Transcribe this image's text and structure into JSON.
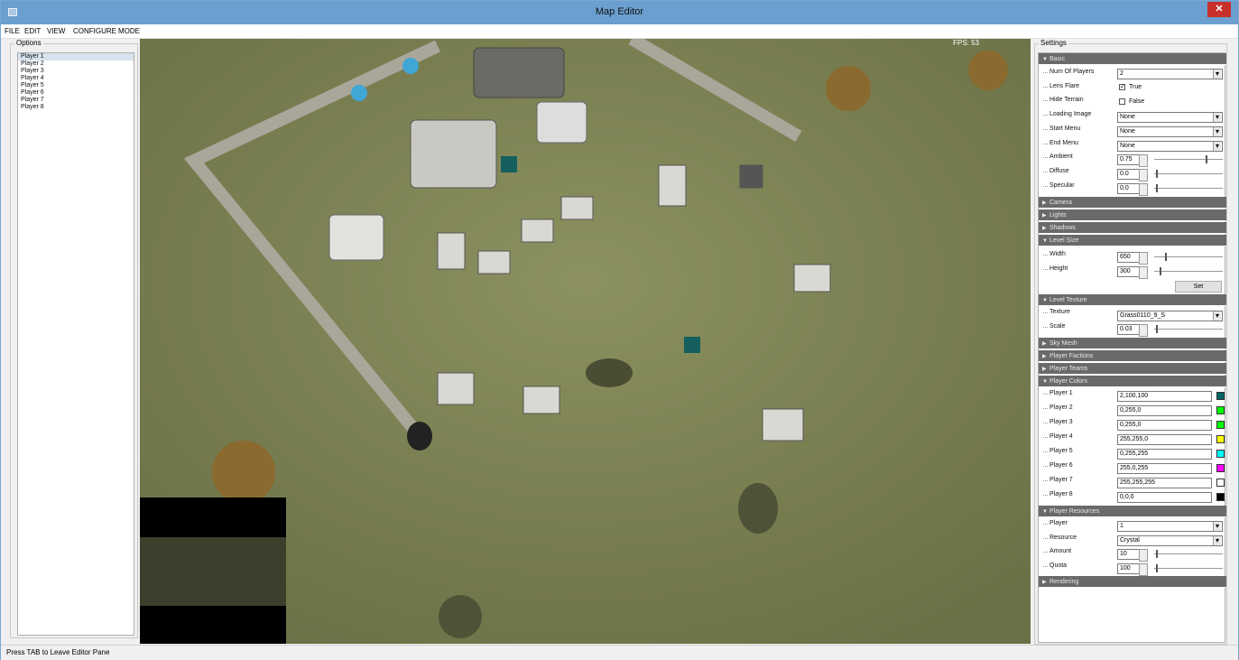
{
  "window": {
    "title": "Map Editor",
    "close_glyph": "✕"
  },
  "menu": [
    "FILE",
    "EDIT",
    "VIEW",
    "CONFIGURE",
    "MODE"
  ],
  "options": {
    "legend": "Options",
    "players": [
      "Player 1",
      "Player 2",
      "Player 3",
      "Player 4",
      "Player 5",
      "Player 6",
      "Player 7",
      "Player 8"
    ],
    "selected_index": 0
  },
  "viewport": {
    "fps": "FPS: 53"
  },
  "settings": {
    "legend": "Settings",
    "basic": {
      "header": "Basic",
      "num_players_label": "Num Of Players",
      "num_players_value": "2",
      "lens_flare_label": "Lens Flare",
      "lens_flare_checked": true,
      "lens_flare_text": "True",
      "hide_terrain_label": "Hide Terrain",
      "hide_terrain_checked": false,
      "hide_terrain_text": "False",
      "loading_image_label": "Loading Image",
      "loading_image_value": "None",
      "start_menu_label": "Start Menu",
      "start_menu_value": "None",
      "end_menu_label": "End Menu",
      "end_menu_value": "None",
      "ambient_label": "Ambient",
      "ambient_value": "0.75",
      "diffuse_label": "Diffuse",
      "diffuse_value": "0.0",
      "specular_label": "Specular",
      "specular_value": "0.0"
    },
    "collapsed_sections": {
      "camera": "Camera",
      "lights": "Lights",
      "shadows": "Shadows"
    },
    "level_size": {
      "header": "Level Size",
      "width_label": "Width",
      "width_value": "650",
      "height_label": "Height",
      "height_value": "300",
      "set_button": "Set"
    },
    "level_texture": {
      "header": "Level Texture",
      "texture_label": "Texture",
      "texture_value": "Grass0110_9_S",
      "scale_label": "Scale",
      "scale_value": "0.03"
    },
    "collapsed_sections2": {
      "sky_mesh": "Sky Mesh",
      "player_factions": "Player Factions",
      "player_teams": "Player Teams"
    },
    "player_colors": {
      "header": "Player Colors",
      "rows": [
        {
          "label": "Player 1",
          "value": "2,100,100",
          "color": "#026464"
        },
        {
          "label": "Player 2",
          "value": "0,255,0",
          "color": "#00ff00"
        },
        {
          "label": "Player 3",
          "value": "0,255,0",
          "color": "#00ff00"
        },
        {
          "label": "Player 4",
          "value": "255,255,0",
          "color": "#ffff00"
        },
        {
          "label": "Player 5",
          "value": "0,255,255",
          "color": "#00ffff"
        },
        {
          "label": "Player 6",
          "value": "255,0,255",
          "color": "#ff00ff"
        },
        {
          "label": "Player 7",
          "value": "255,255,255",
          "color": "#ffffff"
        },
        {
          "label": "Player 8",
          "value": "0,0,0",
          "color": "#000000"
        }
      ]
    },
    "player_resources": {
      "header": "Player Resources",
      "player_label": "Player",
      "player_value": "1",
      "resource_label": "Resource",
      "resource_value": "Crystal",
      "amount_label": "Amount",
      "amount_value": "10",
      "quota_label": "Quota",
      "quota_value": "100"
    },
    "rendering": {
      "header": "Rendering"
    }
  },
  "status": {
    "text": "Press TAB to Leave Editor Pane"
  },
  "colors": {
    "titlebar": "#6a9fcf",
    "close": "#c7302a",
    "section_header": "#6a6a6a",
    "grass": "#798052"
  }
}
